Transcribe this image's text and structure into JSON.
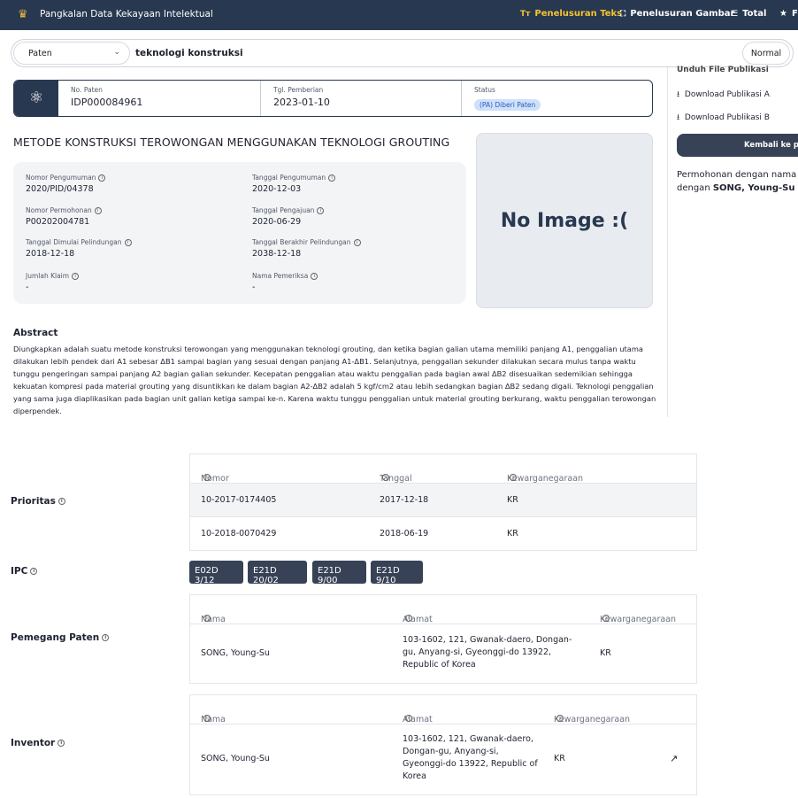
{
  "topbar": {
    "brand": "Pangkalan Data Kekayaan Intelektual",
    "nav": [
      {
        "label": "Penelusuran Teks",
        "icon": "text-search-icon",
        "active": true
      },
      {
        "label": "Penelusuran Gambar",
        "icon": "image-search-icon",
        "active": false
      },
      {
        "label": "Total",
        "icon": "list-icon",
        "active": false
      },
      {
        "label": "F",
        "icon": "star-icon",
        "active": false
      }
    ]
  },
  "search": {
    "type": "Paten",
    "query": "teknologi konstruksi",
    "mode": "Normal"
  },
  "patent": {
    "no_label": "No. Paten",
    "no": "IDP000084961",
    "grant_label": "Tgl. Pemberian",
    "grant": "2023-01-10",
    "status_label": "Status",
    "status": "(PA) Diberi Paten",
    "title": "METODE KONSTRUKSI TEROWONGAN MENGGUNAKAN TEKNOLOGI GROUTING"
  },
  "fields": [
    {
      "label": "Nomor Pengumuman",
      "value": "2020/PID/04378"
    },
    {
      "label": "Tanggal Pengumuman",
      "value": "2020-12-03"
    },
    {
      "label": "Nomor Permohonan",
      "value": "P00202004781"
    },
    {
      "label": "Tanggal Pengajuan",
      "value": "2020-06-29"
    },
    {
      "label": "Tanggal Dimulai Pelindungan",
      "value": "2018-12-18"
    },
    {
      "label": "Tanggal Berakhir Pelindungan",
      "value": "2038-12-18"
    },
    {
      "label": "Jumlah Klaim",
      "value": "-"
    },
    {
      "label": "Nama Pemeriksa",
      "value": "-"
    }
  ],
  "no_image": "No Image :(",
  "abstract": {
    "heading": "Abstract",
    "text": "Diungkapkan adalah suatu metode konstruksi terowongan yang menggunakan teknologi grouting, dan ketika bagian galian utama memiliki panjang A1, penggalian utama dilakukan lebih pendek dari A1 sebesar ΔB1 sampai bagian yang sesuai dengan panjang A1-ΔB1. Selanjutnya, penggalian sekunder dilakukan secara mulus tanpa waktu tunggu pengeringan sampai panjang A2 bagian galian sekunder. Kecepatan penggalian atau waktu penggalian pada bagian awal ΔB2 disesuaikan sedemikian sehingga kekuatan kompresi pada material grouting yang disuntikkan ke dalam bagian A2-ΔB2 adalah 5 kgf/cm2 atau lebih sedangkan bagian ΔB2 sedang digali. Teknologi penggalian yang sama juga diaplikasikan pada bagian unit galian ketiga sampai ke-n. Karena waktu tunggu penggalian untuk material grouting berkurang, waktu penggalian terowongan diperpendek."
  },
  "sidebar": {
    "hidden_heading": "Unduh File Publikasi",
    "download_a": "Download Publikasi A",
    "download_b": "Download Publikasi B",
    "back": "Kembali ke pe",
    "note_1": "Permohonan dengan nama",
    "note_2_prefix": "dengan ",
    "note_2_name": "SONG, Young-Su"
  },
  "prioritas": {
    "label": "Prioritas",
    "headers": [
      "Nomor",
      "Tanggal",
      "Kewarganegaraan"
    ],
    "rows": [
      [
        "10-2017-0174405",
        "2017-12-18",
        "KR"
      ],
      [
        "10-2018-0070429",
        "2018-06-19",
        "KR"
      ]
    ]
  },
  "ipc": {
    "label": "IPC",
    "codes": [
      "E02D 3/12",
      "E21D 20/02",
      "E21D 9/00",
      "E21D 9/10"
    ]
  },
  "holder": {
    "label": "Pemegang Paten",
    "headers": [
      "Nama",
      "Alamat",
      "Kewarganegaraan"
    ],
    "name": "SONG, Young-Su",
    "address": "103-1602, 121, Gwanak-daero, Dongan-gu, Anyang-si, Gyeonggi-do 13922, Republic of Korea",
    "country": "KR"
  },
  "inventor": {
    "label": "Inventor",
    "headers": [
      "Nama",
      "Alamat",
      "Kewarganegaraan"
    ],
    "name": "SONG, Young-Su",
    "address": "103-1602, 121, Gwanak-daero, Dongan-gu, Anyang-si, Gyeonggi-do 13922, Republic of Korea",
    "country": "KR"
  }
}
